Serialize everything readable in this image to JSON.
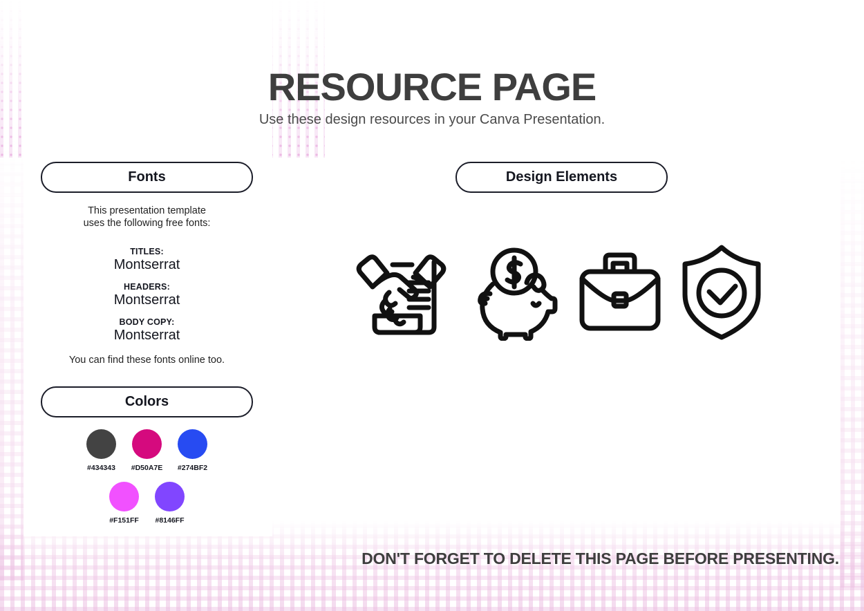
{
  "header": {
    "title": "RESOURCE PAGE",
    "subtitle": "Use these design resources in your Canva Presentation."
  },
  "fonts_section": {
    "pill_label": "Fonts",
    "intro": "This presentation template\nuses the following free fonts:",
    "rows": [
      {
        "label": "TITLES:",
        "value": "Montserrat"
      },
      {
        "label": "HEADERS:",
        "value": "Montserrat"
      },
      {
        "label": "BODY COPY:",
        "value": "Montserrat"
      }
    ],
    "outro": "You can find these fonts online too."
  },
  "colors_section": {
    "pill_label": "Colors",
    "row1": [
      {
        "hex": "#434343",
        "label": "#434343"
      },
      {
        "hex": "#D50A7E",
        "label": "#D50A7E"
      },
      {
        "hex": "#274BF2",
        "label": "#274BF2"
      }
    ],
    "row2": [
      {
        "hex": "#F151FF",
        "label": "#F151FF"
      },
      {
        "hex": "#8146FF",
        "label": "#8146FF"
      }
    ]
  },
  "design_section": {
    "pill_label": "Design Elements",
    "icons": [
      "handshake-document-icon",
      "piggy-bank-icon",
      "briefcase-icon",
      "shield-check-icon"
    ]
  },
  "footer": {
    "note": "DON'T FORGET TO DELETE THIS PAGE BEFORE PRESENTING."
  },
  "theme": {
    "title_color": "#3E3E3E",
    "text_color": "#14161F",
    "pill_border": "#1B1D29",
    "pattern_pink": "#ECBEE1",
    "background": "#FFFFFF"
  }
}
